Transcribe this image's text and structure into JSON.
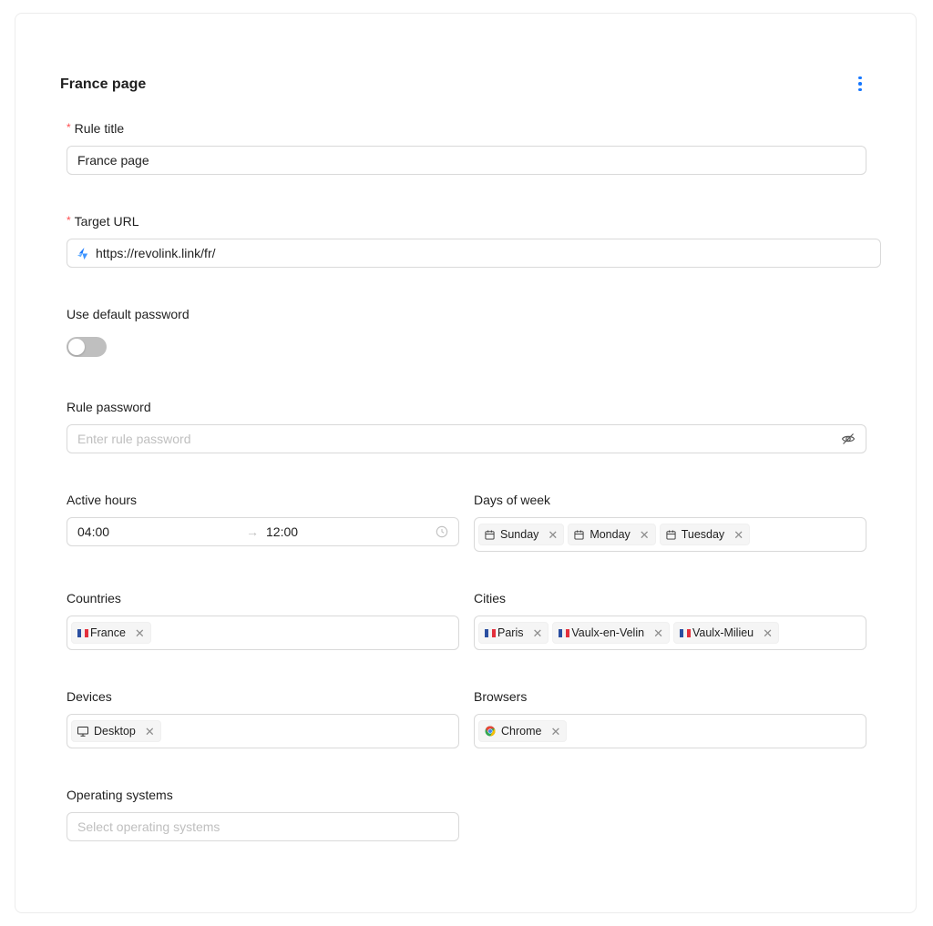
{
  "header": {
    "title": "France page",
    "menu_icon": "more-vertical-icon"
  },
  "form": {
    "rule_title": {
      "label": "Rule title",
      "value": "France page"
    },
    "target_url": {
      "label": "Target URL",
      "value": "https://revolink.link/fr/"
    },
    "default_password": {
      "label": "Use default password",
      "enabled": false
    },
    "rule_password": {
      "label": "Rule password",
      "placeholder": "Enter rule password"
    },
    "active_hours": {
      "label": "Active hours",
      "start": "04:00",
      "arrow": "→",
      "end": "12:00"
    },
    "days_of_week": {
      "label": "Days of week",
      "tags": [
        "Sunday",
        "Monday",
        "Tuesday"
      ]
    },
    "countries": {
      "label": "Countries",
      "tags": [
        "France"
      ]
    },
    "cities": {
      "label": "Cities",
      "tags": [
        "Paris",
        "Vaulx-en-Velin",
        "Vaulx-Milieu"
      ]
    },
    "devices": {
      "label": "Devices",
      "tags": [
        "Desktop"
      ]
    },
    "browsers": {
      "label": "Browsers",
      "tags": [
        "Chrome"
      ]
    },
    "operating_systems": {
      "label": "Operating systems",
      "placeholder": "Select operating systems"
    }
  },
  "colors": {
    "accent": "#1677ff",
    "required": "#ff4d4f",
    "border": "#d9d9d9",
    "toggle_off": "#bfbfbf"
  }
}
